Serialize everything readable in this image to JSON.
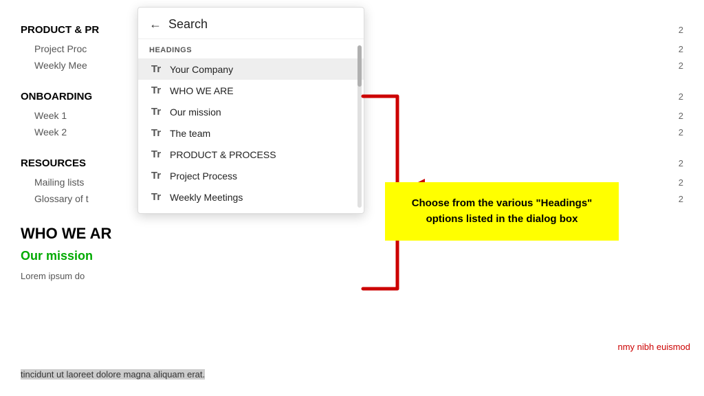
{
  "doc": {
    "sections": [
      {
        "type": "heading",
        "text": "PRODUCT & PR",
        "number": "2"
      },
      {
        "type": "item",
        "text": "Project Proc",
        "number": "2"
      },
      {
        "type": "item",
        "text": "Weekly Mee",
        "number": "2"
      },
      {
        "type": "heading",
        "text": "ONBOARDING",
        "number": "2"
      },
      {
        "type": "item",
        "text": "Week 1",
        "number": "2"
      },
      {
        "type": "item",
        "text": "Week 2",
        "number": "2"
      },
      {
        "type": "heading",
        "text": "RESOURCES",
        "number": "2"
      },
      {
        "type": "item",
        "text": "Mailing lists",
        "number": "2"
      },
      {
        "type": "item",
        "text": "Glossary of t",
        "number": "2"
      }
    ],
    "h1": "WHO WE AR",
    "h2": "Our mission",
    "body1": "Lorem ipsum do",
    "body2_highlight": "tincidunt ut laoreet dolore magna aliquam erat.",
    "body_right": "nmy nibh euismod"
  },
  "search_panel": {
    "back_label": "←",
    "title": "Search",
    "section_label": "HEADINGS",
    "items": [
      {
        "icon": "Tr",
        "text": "Your Company",
        "active": true
      },
      {
        "icon": "Tr",
        "text": "WHO WE ARE",
        "active": false
      },
      {
        "icon": "Tr",
        "text": "Our mission",
        "active": false
      },
      {
        "icon": "Tr",
        "text": "The team",
        "active": false
      },
      {
        "icon": "Tr",
        "text": "PRODUCT & PROCESS",
        "active": false
      },
      {
        "icon": "Tr",
        "text": "Project Process",
        "active": false
      },
      {
        "icon": "Tr",
        "text": "Weekly Meetings",
        "active": false
      }
    ]
  },
  "tooltip": {
    "text": "Choose from the various \"Headings\" options listed  in the dialog box"
  }
}
